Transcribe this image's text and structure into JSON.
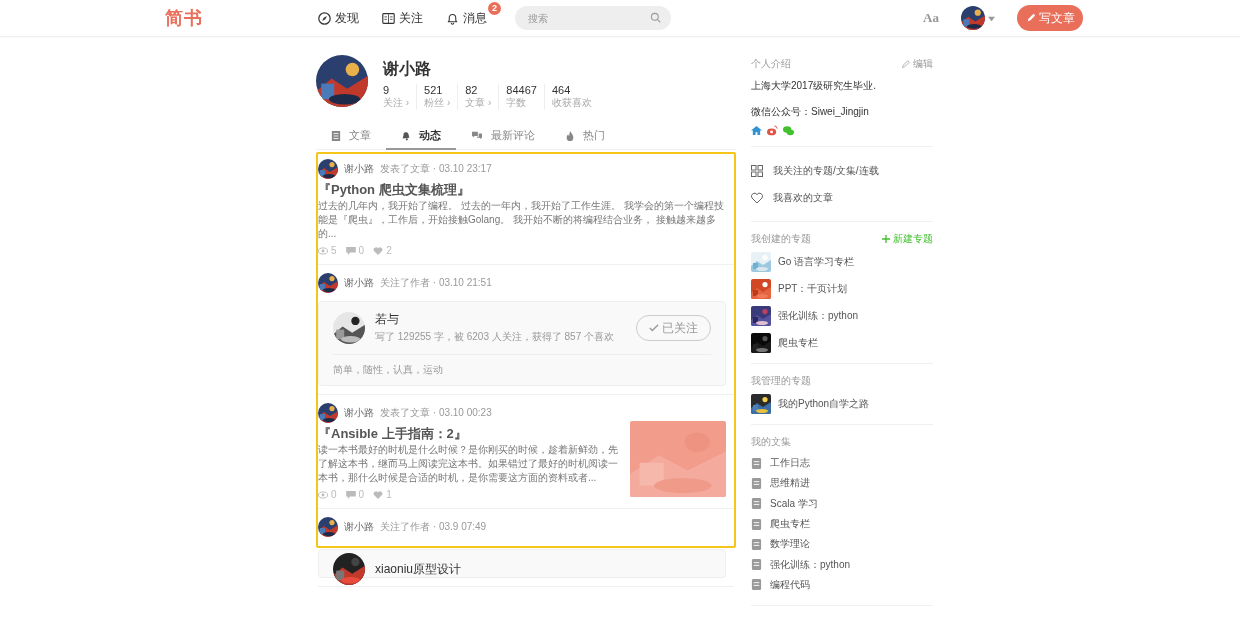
{
  "header": {
    "logo": "简书",
    "nav": [
      {
        "label": "发现",
        "selected": false
      },
      {
        "label": "关注",
        "selected": false
      },
      {
        "label": "消息",
        "selected": false,
        "badge": "2"
      }
    ],
    "search": {
      "placeholder": "搜索"
    },
    "font_button": "Aa",
    "write_button": "写文章"
  },
  "profile": {
    "name": "谢小路",
    "stats": [
      {
        "value": "9",
        "label": "关注 ›"
      },
      {
        "value": "521",
        "label": "粉丝 ›"
      },
      {
        "value": "82",
        "label": "文章 ›"
      },
      {
        "value": "84467",
        "label": "字数"
      },
      {
        "value": "464",
        "label": "收获喜欢"
      }
    ]
  },
  "tabs": [
    {
      "label": "文章",
      "selected": false
    },
    {
      "label": "动态",
      "selected": true
    },
    {
      "label": "最新评论",
      "selected": false
    },
    {
      "label": "热门",
      "selected": false
    }
  ],
  "feed": [
    {
      "kind": "article",
      "author": "谢小路",
      "meta": "发表了文章 · 03.10 23:17",
      "title": "『Python 爬虫文集梳理』",
      "abstract": "过去的几年内，我开始了编程。 过去的一年内，我开始了工作生涯。 我学会的第一个编程技能是『爬虫』，工作后，开始接触Golang。 我开始不断的将编程结合业务， 接触越来越多的...",
      "views": "5",
      "comments": "0",
      "likes": "2"
    },
    {
      "kind": "follow",
      "author": "谢小路",
      "meta": "关注了作者 · 03.10 21:51",
      "user": {
        "name": "若与",
        "meta": "写了 129255 字，被 6203 人关注，获得了 857 个喜欢",
        "button": "已关注",
        "followed": true,
        "intro": "简单，随性，认真，运动"
      }
    },
    {
      "kind": "article",
      "author": "谢小路",
      "meta": "发表了文章 · 03.10 00:23",
      "title": "『Ansible 上手指南：2』",
      "abstract": "读一本书最好的时机是什么时候？是你刚买的时候，趁着新鲜劲，先了解这本书，继而马上阅读完这本书。如果错过了最好的时机阅读一本书，那什么时候是合适的时机，是你需要这方面的资料或者...",
      "views": "0",
      "comments": "0",
      "likes": "1"
    },
    {
      "kind": "follow",
      "author": "谢小路",
      "meta": "关注了作者 · 03.9 07:49",
      "user": {
        "name": "xiaoniu原型设计"
      }
    }
  ],
  "sidebar": {
    "intro": {
      "title": "个人介绍",
      "edit": "编辑",
      "text": "上海大学2017级研究生毕业.",
      "wechat": "微信公众号：Siwei_Jingjin"
    },
    "links": [
      "我关注的专题/文集/连载",
      "我喜欢的文章"
    ],
    "created": {
      "title": "我创建的专题",
      "action": "新建专题",
      "items": [
        "Go 语言学习专栏",
        "PPT：千页计划",
        "强化训练：python",
        "爬虫专栏"
      ]
    },
    "managed": {
      "title": "我管理的专题",
      "items": [
        "我的Python自学之路"
      ]
    },
    "notebooks": {
      "title": "我的文集",
      "items": [
        "工作日志",
        "思维精进",
        "Scala 学习",
        "爬虫专栏",
        "数学理论",
        "强化训练：python",
        "编程代码"
      ]
    }
  }
}
